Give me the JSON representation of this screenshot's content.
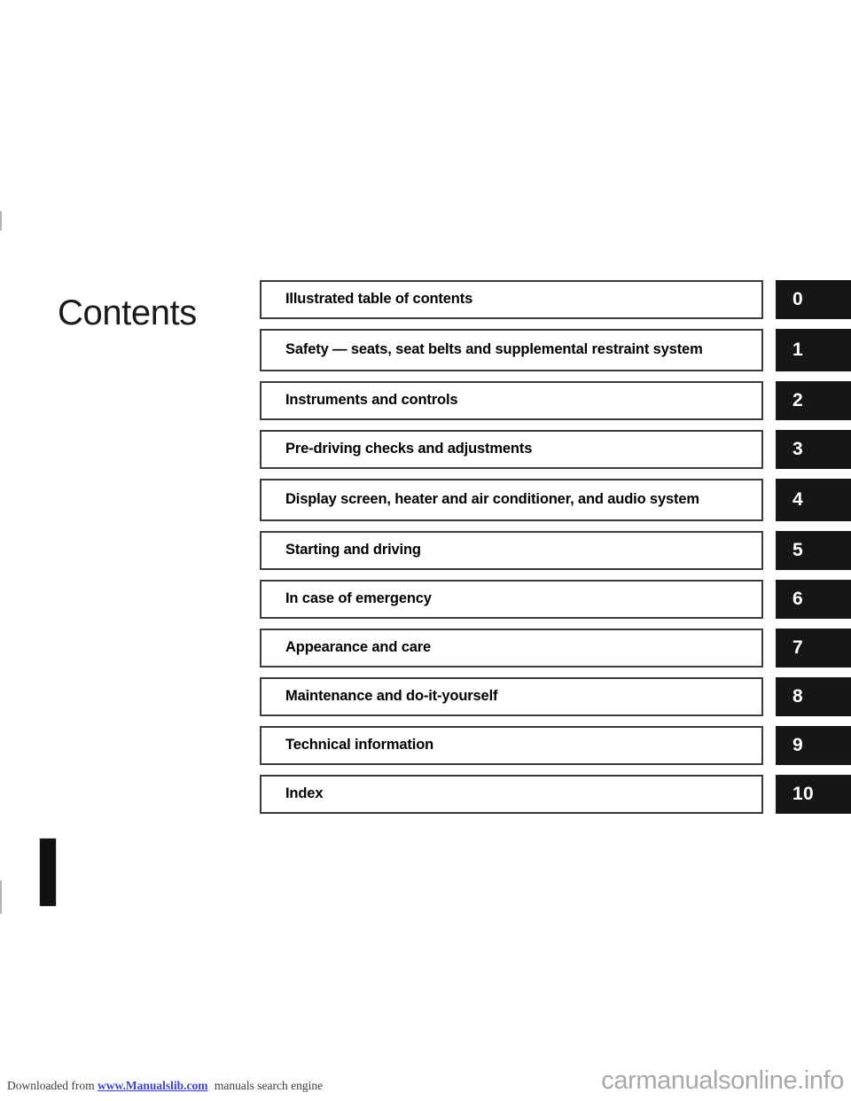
{
  "page": {
    "title": "Contents",
    "marker_label": "I"
  },
  "toc": {
    "rows": [
      {
        "label": "Illustrated table of contents",
        "tab": "0",
        "lines": 1
      },
      {
        "label": "Safety — seats, seat belts and supplemental restraint system",
        "tab": "1",
        "lines": 2
      },
      {
        "label": "Instruments and controls",
        "tab": "2",
        "lines": 1
      },
      {
        "label": "Pre-driving checks and adjustments",
        "tab": "3",
        "lines": 1
      },
      {
        "label": "Display screen, heater and air conditioner, and audio system",
        "tab": "4",
        "lines": 2
      },
      {
        "label": "Starting and driving",
        "tab": "5",
        "lines": 1
      },
      {
        "label": "In case of emergency",
        "tab": "6",
        "lines": 1
      },
      {
        "label": "Appearance and care",
        "tab": "7",
        "lines": 1
      },
      {
        "label": "Maintenance and do-it-yourself",
        "tab": "8",
        "lines": 1
      },
      {
        "label": "Technical information",
        "tab": "9",
        "lines": 1
      },
      {
        "label": "Index",
        "tab": "10",
        "lines": 1
      }
    ]
  },
  "footer": {
    "prefix": "Downloaded from",
    "link_text": "www.Manualslib.com",
    "suffix": "manuals search engine",
    "watermark": "carmanualsonline.info"
  },
  "colors": {
    "tab_background": "#161616",
    "tab_text": "#ffffff",
    "box_border": "#3b3b3b",
    "link": "#3b42d6",
    "watermark": "#a8a8a8"
  }
}
